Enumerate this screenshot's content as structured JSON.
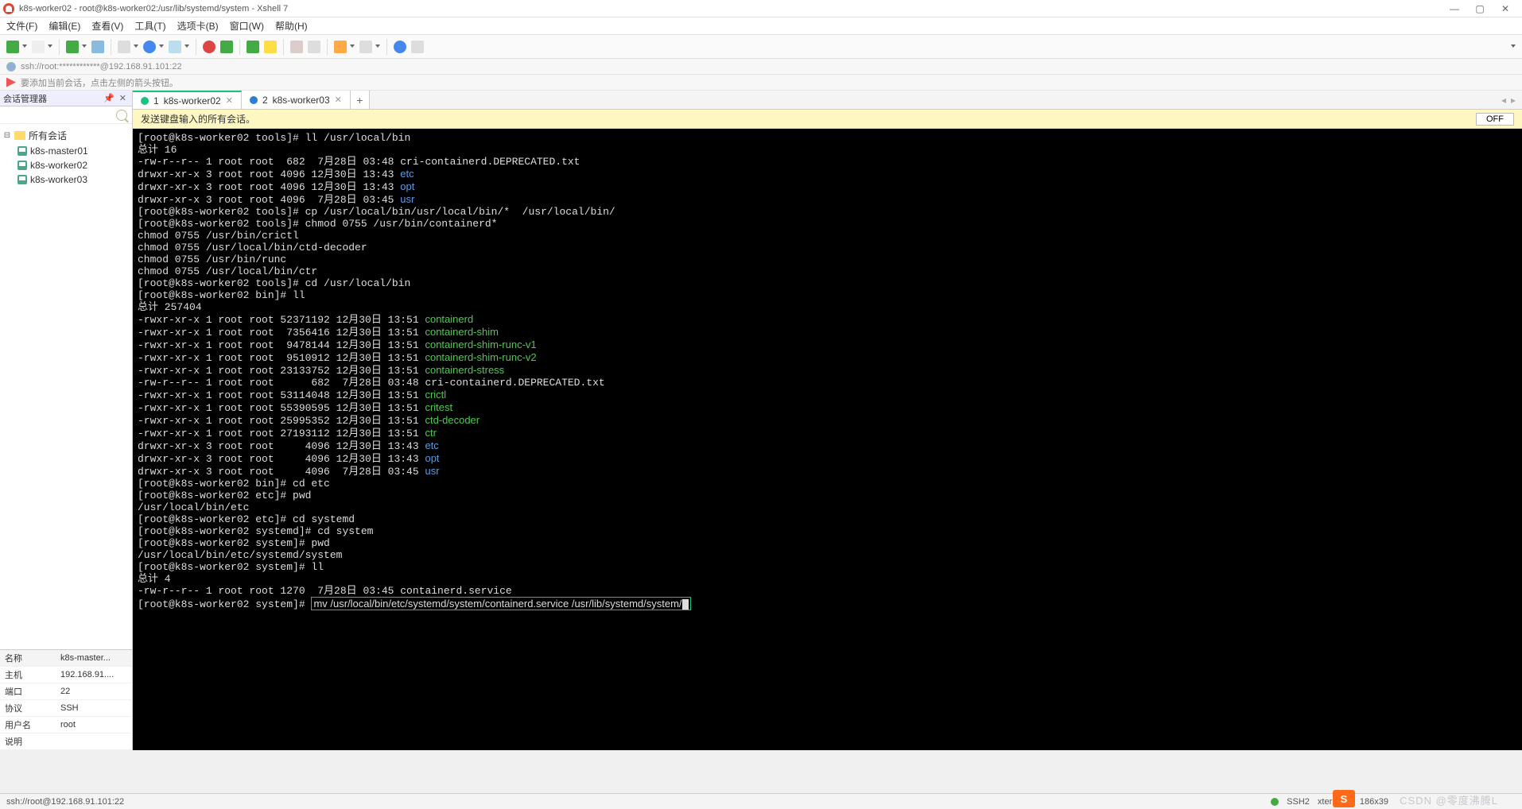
{
  "window": {
    "title": "k8s-worker02 - root@k8s-worker02:/usr/lib/systemd/system - Xshell 7"
  },
  "menus": [
    "文件(F)",
    "编辑(E)",
    "查看(V)",
    "工具(T)",
    "选项卡(B)",
    "窗口(W)",
    "帮助(H)"
  ],
  "addressbar": "ssh://root:************@192.168.91.101:22",
  "tipbar": "要添加当前会话，点击左侧的箭头按钮。",
  "session_manager": {
    "title": "会话管理器",
    "root": "所有会话",
    "items": [
      "k8s-master01",
      "k8s-worker02",
      "k8s-worker03"
    ]
  },
  "properties": {
    "headers": [
      "名称",
      "k8s-master..."
    ],
    "rows": [
      [
        "主机",
        "192.168.91...."
      ],
      [
        "端口",
        "22"
      ],
      [
        "协议",
        "SSH"
      ],
      [
        "用户名",
        "root"
      ],
      [
        "说明",
        ""
      ]
    ]
  },
  "tabs": [
    {
      "num": "1",
      "label": "k8s-worker02",
      "active": true,
      "color": "green"
    },
    {
      "num": "2",
      "label": "k8s-worker03",
      "active": false,
      "color": "blue"
    }
  ],
  "warn_strip": {
    "text": "发送键盘输入的所有会话。",
    "button": "OFF"
  },
  "terminal": {
    "lines": [
      {
        "t": "[root@k8s-worker02 tools]# ll /usr/local/bin"
      },
      {
        "t": "总计 16"
      },
      {
        "t": "-rw-r--r-- 1 root root  682  7月28日 03:48 cri-containerd.DEPRECATED.txt"
      },
      {
        "t": "drwxr-xr-x 3 root root 4096 12月30日 13:43 ",
        "tail": "etc",
        "cls": "c-blue"
      },
      {
        "t": "drwxr-xr-x 3 root root 4096 12月30日 13:43 ",
        "tail": "opt",
        "cls": "c-blue"
      },
      {
        "t": "drwxr-xr-x 3 root root 4096  7月28日 03:45 ",
        "tail": "usr",
        "cls": "c-blue"
      },
      {
        "t": "[root@k8s-worker02 tools]# cp /usr/local/bin/usr/local/bin/*  /usr/local/bin/"
      },
      {
        "t": "[root@k8s-worker02 tools]# chmod 0755 /usr/bin/containerd*"
      },
      {
        "t": "chmod 0755 /usr/bin/crictl"
      },
      {
        "t": "chmod 0755 /usr/local/bin/ctd-decoder"
      },
      {
        "t": "chmod 0755 /usr/bin/runc"
      },
      {
        "t": "chmod 0755 /usr/local/bin/ctr"
      },
      {
        "t": "[root@k8s-worker02 tools]# cd /usr/local/bin"
      },
      {
        "t": "[root@k8s-worker02 bin]# ll"
      },
      {
        "t": "总计 257404"
      },
      {
        "t": "-rwxr-xr-x 1 root root 52371192 12月30日 13:51 ",
        "tail": "containerd",
        "cls": "c-green"
      },
      {
        "t": "-rwxr-xr-x 1 root root  7356416 12月30日 13:51 ",
        "tail": "containerd-shim",
        "cls": "c-green"
      },
      {
        "t": "-rwxr-xr-x 1 root root  9478144 12月30日 13:51 ",
        "tail": "containerd-shim-runc-v1",
        "cls": "c-green"
      },
      {
        "t": "-rwxr-xr-x 1 root root  9510912 12月30日 13:51 ",
        "tail": "containerd-shim-runc-v2",
        "cls": "c-green"
      },
      {
        "t": "-rwxr-xr-x 1 root root 23133752 12月30日 13:51 ",
        "tail": "containerd-stress",
        "cls": "c-green"
      },
      {
        "t": "-rw-r--r-- 1 root root      682  7月28日 03:48 cri-containerd.DEPRECATED.txt"
      },
      {
        "t": "-rwxr-xr-x 1 root root 53114048 12月30日 13:51 ",
        "tail": "crictl",
        "cls": "c-green"
      },
      {
        "t": "-rwxr-xr-x 1 root root 55390595 12月30日 13:51 ",
        "tail": "critest",
        "cls": "c-green"
      },
      {
        "t": "-rwxr-xr-x 1 root root 25995352 12月30日 13:51 ",
        "tail": "ctd-decoder",
        "cls": "c-green"
      },
      {
        "t": "-rwxr-xr-x 1 root root 27193112 12月30日 13:51 ",
        "tail": "ctr",
        "cls": "c-green"
      },
      {
        "t": "drwxr-xr-x 3 root root     4096 12月30日 13:43 ",
        "tail": "etc",
        "cls": "c-blue"
      },
      {
        "t": "drwxr-xr-x 3 root root     4096 12月30日 13:43 ",
        "tail": "opt",
        "cls": "c-blue"
      },
      {
        "t": "drwxr-xr-x 3 root root     4096  7月28日 03:45 ",
        "tail": "usr",
        "cls": "c-blue"
      },
      {
        "t": "[root@k8s-worker02 bin]# cd etc"
      },
      {
        "t": "[root@k8s-worker02 etc]# pwd"
      },
      {
        "t": "/usr/local/bin/etc"
      },
      {
        "t": "[root@k8s-worker02 etc]# cd systemd"
      },
      {
        "t": "[root@k8s-worker02 systemd]# cd system"
      },
      {
        "t": "[root@k8s-worker02 system]# pwd"
      },
      {
        "t": "/usr/local/bin/etc/systemd/system"
      },
      {
        "t": "[root@k8s-worker02 system]# ll"
      },
      {
        "t": "总计 4"
      },
      {
        "t": "-rw-r--r-- 1 root root 1270  7月28日 03:45 containerd.service"
      }
    ],
    "prompt": "[root@k8s-worker02 system]# ",
    "boxed": "mv /usr/local/bin/etc/systemd/system/containerd.service /usr/lib/systemd/system/"
  },
  "statusbar": {
    "left": "ssh://root@192.168.91.101:22",
    "ssh": "SSH2",
    "term": "xterm",
    "size": "186x39",
    "ime": "S",
    "watermark": "CSDN @零度沸腾L"
  }
}
